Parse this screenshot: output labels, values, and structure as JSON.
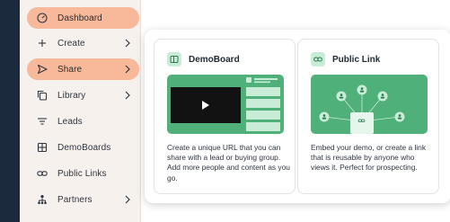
{
  "sidebar": {
    "items": [
      {
        "label": "Dashboard",
        "icon": "dashboard-gauge-icon",
        "active": true,
        "has_submenu": false
      },
      {
        "label": "Create",
        "icon": "plus-icon",
        "active": false,
        "has_submenu": true
      },
      {
        "label": "Share",
        "icon": "share-send-icon",
        "active": true,
        "has_submenu": true
      },
      {
        "label": "Library",
        "icon": "library-copy-icon",
        "active": false,
        "has_submenu": true
      },
      {
        "label": "Leads",
        "icon": "leads-filter-icon",
        "active": false,
        "has_submenu": false
      },
      {
        "label": "DemoBoards",
        "icon": "demoboards-grid-icon",
        "active": false,
        "has_submenu": false
      },
      {
        "label": "Public Links",
        "icon": "link-icon",
        "active": false,
        "has_submenu": false
      },
      {
        "label": "Partners",
        "icon": "partners-org-icon",
        "active": false,
        "has_submenu": true
      }
    ]
  },
  "share_menu": {
    "demoboard": {
      "title": "DemoBoard",
      "icon": "demoboard-icon",
      "description": "Create a unique URL that you can share with a lead or buying group. Add more people and content as you go."
    },
    "public_link": {
      "title": "Public Link",
      "icon": "link-icon",
      "description": "Embed your demo, or create a link that is reusable by anyone who views it. Perfect for prospecting."
    }
  },
  "colors": {
    "sidebar_bg": "#f6f1ec",
    "active_item": "#f8b89a",
    "accent_green": "#4fb07a",
    "light_green": "#c8ecd5",
    "dark_navy": "#1b2a3d",
    "brand_orange": "#f07f2c"
  }
}
